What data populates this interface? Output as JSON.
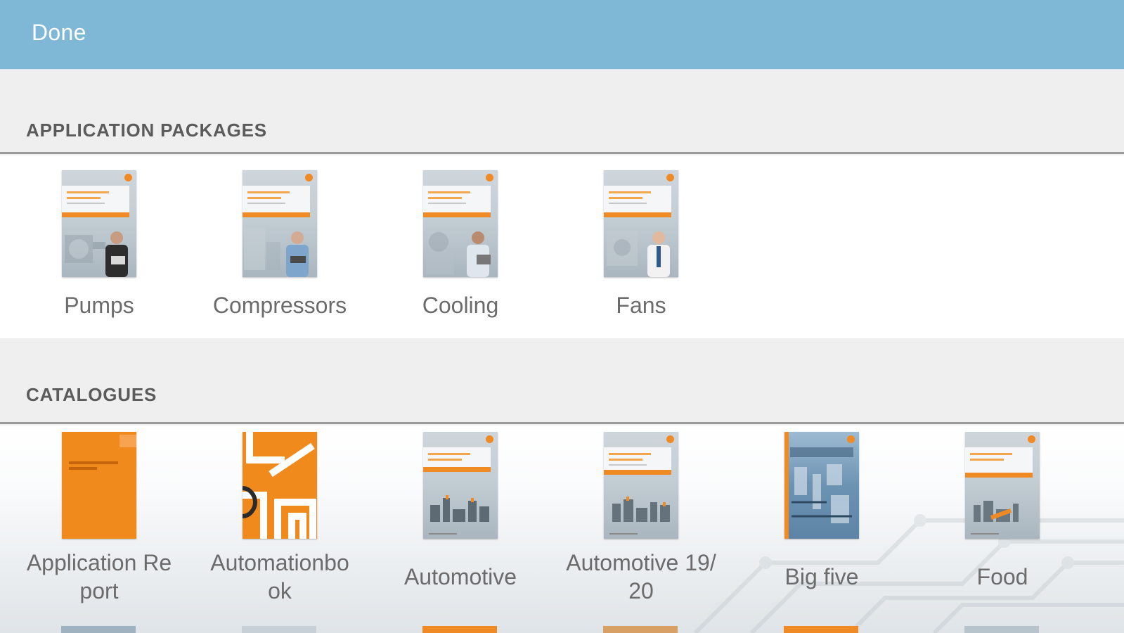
{
  "header": {
    "done_label": "Done"
  },
  "sections": {
    "application_packages": {
      "title": "APPLICATION PACKAGES",
      "items": [
        {
          "label": "Pumps"
        },
        {
          "label": "Compressors"
        },
        {
          "label": "Cooling"
        },
        {
          "label": "Fans"
        }
      ]
    },
    "catalogues": {
      "title": "CATALOGUES",
      "items": [
        {
          "label_line1": "Application Re",
          "label_line2": "port"
        },
        {
          "label_line1": "Automationbo",
          "label_line2": "ok"
        },
        {
          "label_line1": "Automotive",
          "label_line2": ""
        },
        {
          "label_line1": "Automotive 19/",
          "label_line2": "20"
        },
        {
          "label_line1": "Big five",
          "label_line2": ""
        },
        {
          "label_line1": "Food",
          "label_line2": ""
        }
      ]
    }
  },
  "colors": {
    "topbar": "#7fb7d6",
    "accent_orange": "#f08a24",
    "section_text": "#5b5b5b",
    "item_text": "#6b6b6b"
  }
}
